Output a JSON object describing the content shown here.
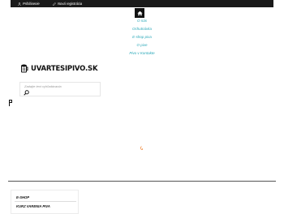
{
  "topbar": {
    "login_label": "Prihlásenie",
    "register_label": "Nová registrácia"
  },
  "nav": {
    "items": [
      "O nás",
      "Ochutnávka",
      "E-shop piva",
      "O pive",
      "Pivo v Kontakte"
    ]
  },
  "brand": {
    "name": "UVARTESIPIVO.SK"
  },
  "search": {
    "placeholder": "Zadajte text vyhľadávania"
  },
  "footer": {
    "menu_title": "E-SHOP",
    "menu_item": "KURZ VARENIA PIVA"
  },
  "colors": {
    "topbar_bg": "#1a1a1a",
    "nav_link": "#28a7b8",
    "spinner": "#f08a3c"
  },
  "icons": {
    "home": "home-icon",
    "user": "user-icon",
    "register": "pencil-icon",
    "search": "search-icon",
    "logo": "beer-mug-icon"
  }
}
